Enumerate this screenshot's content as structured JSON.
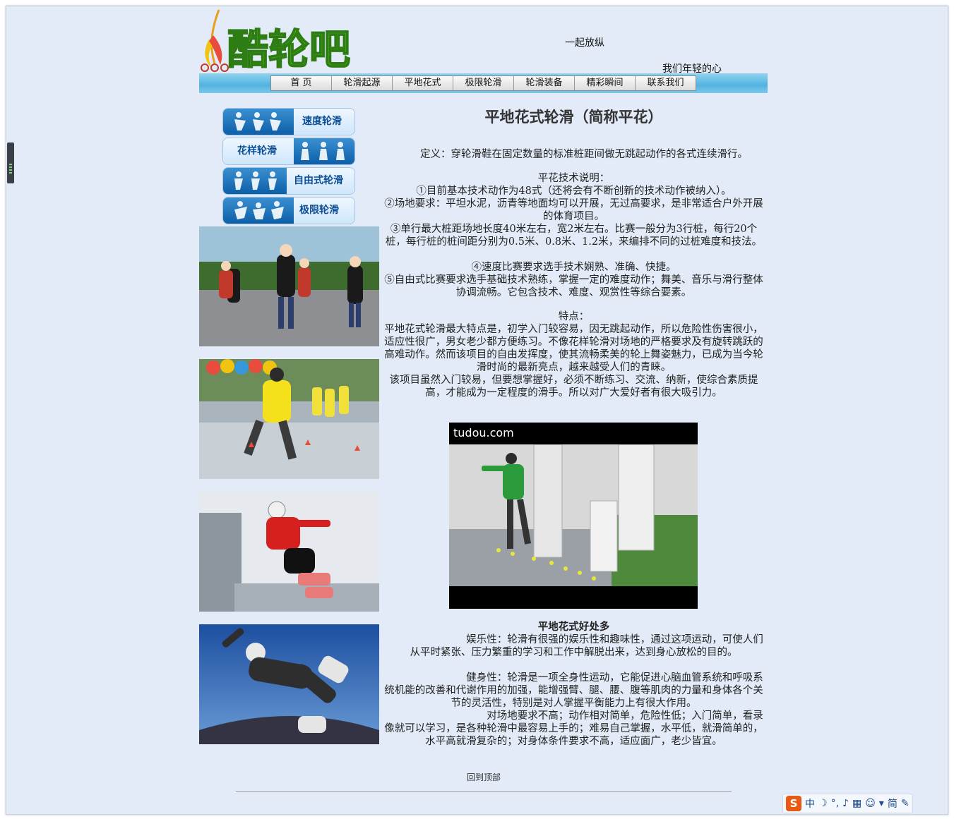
{
  "header": {
    "logo_text": "酷轮吧",
    "slogan_line1": "一起放纵",
    "slogan_line2": "我们年轻的心"
  },
  "nav": {
    "items": [
      "首 页",
      "轮滑起源",
      "平地花式",
      "极限轮滑",
      "轮滑装备",
      "精彩瞬间",
      "联系我们"
    ]
  },
  "sidebar": {
    "buttons": [
      "速度轮滑",
      "花样轮滑",
      "自由式轮滑",
      "极限轮滑"
    ]
  },
  "main": {
    "title": "平地花式轮滑（简称平花）",
    "definition": "定义：穿轮滑鞋在固定数量的标准桩距间做无跳起动作的各式连续滑行。",
    "tech_heading": "平花技术说明：",
    "tech_1": "①目前基本技术动作为48式（还将会有不断创新的技术动作被纳入）。",
    "tech_2": "②场地要求：平坦水泥，沥青等地面均可以开展，无过高要求，是非常适合户外开展的体育项目。",
    "tech_3": "③单行最大桩距场地长度40米左右，宽2米左右。比赛一般分为3行桩，每行20个桩，每行桩的桩间距分别为0.5米、0.8米、1.2米，来编排不同的过桩难度和技法。",
    "tech_4": "④速度比赛要求选手技术娴熟、准确、快捷。",
    "tech_5": "⑤自由式比赛要求选手基础技术熟练，掌握一定的难度动作；舞美、音乐与滑行整体协调流畅。它包含技术、难度、观赏性等综合要素。",
    "feature_heading": "特点：",
    "feature_1": "平地花式轮滑最大特点是，初学入门较容易，因无跳起动作，所以危险性伤害很小，适应性很广，男女老少都方便练习。不像花样轮滑对场地的严格要求及有旋转跳跃的高难动作。然而该项目的自由发挥度，使其流畅柔美的轮上舞姿魅力，已成为当今轮滑时尚的最新亮点，越来越受人们的青睐。",
    "feature_2": "该项目虽然入门较易，但要想掌握好，必须不断练习、交流、纳新，使综合素质提高，才能成为一定程度的滑手。所以对广大爱好者有很大吸引力。",
    "video_brand": "tudou.com",
    "benefits_heading": "平地花式好处多",
    "benefit_1": "娱乐性：轮滑有很强的娱乐性和趣味性，通过这项运动，可使人们从平时紧张、压力繁重的学习和工作中解脱出来，达到身心放松的目的。",
    "benefit_2": "健身性：轮滑是一项全身性运动，它能促进心脑血管系统和呼吸系统机能的改善和代谢作用的加强，能增强臂、腿、腰、腹等肌肉的力量和身体各个关节的灵活性，特别是对人掌握平衡能力上有很大作用。",
    "benefit_3": "对场地要求不高；动作相对简单，危险性低；入门简单，看录像就可以学习，是各种轮滑中最容易上手的；难易自己掌握，水平低，就滑简单的，水平高就滑复杂的；对身体条件要求不高，适应面广，老少皆宜。"
  },
  "footer": {
    "back_to_top": "回到顶部"
  },
  "ime_toolbar": {
    "logo": "S",
    "mode": "中",
    "simplified": "简"
  },
  "colors": {
    "page_bg": "#e2ebf7",
    "nav_bar": "#52b3e0",
    "side_button": "#0d5fa8",
    "logo_green": "#5fc11f"
  }
}
